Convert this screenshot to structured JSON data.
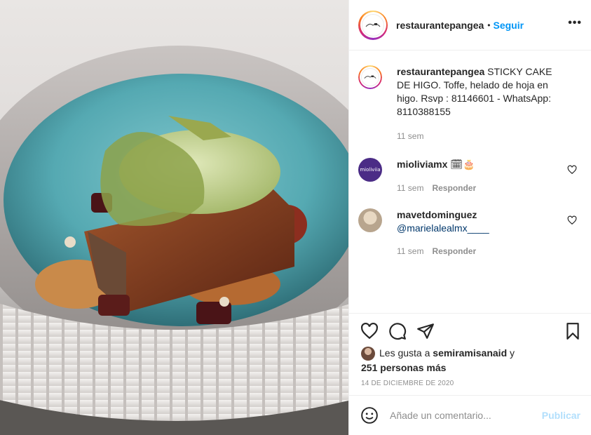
{
  "post": {
    "username": "restaurantepangea",
    "dot": "•",
    "follow_label": "Seguir",
    "more_label": "•••"
  },
  "caption": {
    "username": "restaurantepangea",
    "text": "STICKY CAKE DE HIGO. Toffe, helado de hoja en higo. Rsvp : 81146601 - WhatsApp: 8110388155",
    "time": "11 sem"
  },
  "comments": [
    {
      "username": "mioliviamx",
      "text": "🗓🎂",
      "time": "11 sem",
      "reply_label": "Responder",
      "avatar_text": "mioliviia"
    },
    {
      "username": "mavetdominguez",
      "text": "@marielalealmx____",
      "time": "11 sem",
      "reply_label": "Responder"
    }
  ],
  "likes": {
    "prefix": "Les gusta a",
    "user": "semiramisanaid",
    "connector": "y",
    "others": "251 personas más"
  },
  "date": "14 DE DICIEMBRE DE 2020",
  "add_comment": {
    "placeholder": "Añade un comentario...",
    "publish_label": "Publicar"
  },
  "colors": {
    "follow": "#0095f6",
    "publish_disabled": "#b2dffc",
    "meta": "#8e8e8e"
  }
}
